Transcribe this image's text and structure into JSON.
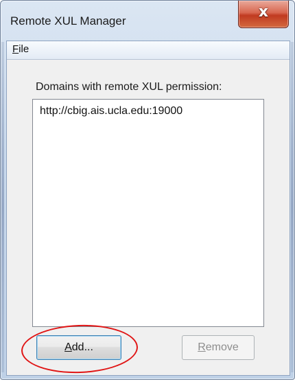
{
  "window": {
    "title": "Remote XUL Manager",
    "close_glyph": "x"
  },
  "menubar": {
    "file": {
      "mnemonic": "F",
      "rest": "ile"
    }
  },
  "main": {
    "list_label": "Domains with remote XUL permission:",
    "items": [
      "http://cbig.ais.ucla.edu:19000"
    ]
  },
  "buttons": {
    "add": {
      "mnemonic": "A",
      "rest": "dd..."
    },
    "remove": {
      "mnemonic": "R",
      "rest": "emove"
    }
  },
  "icons": {
    "close": "close-icon"
  },
  "colors": {
    "close_button": "#c13a20",
    "annotation": "#e01515",
    "focus_border": "#3c7fb1"
  }
}
